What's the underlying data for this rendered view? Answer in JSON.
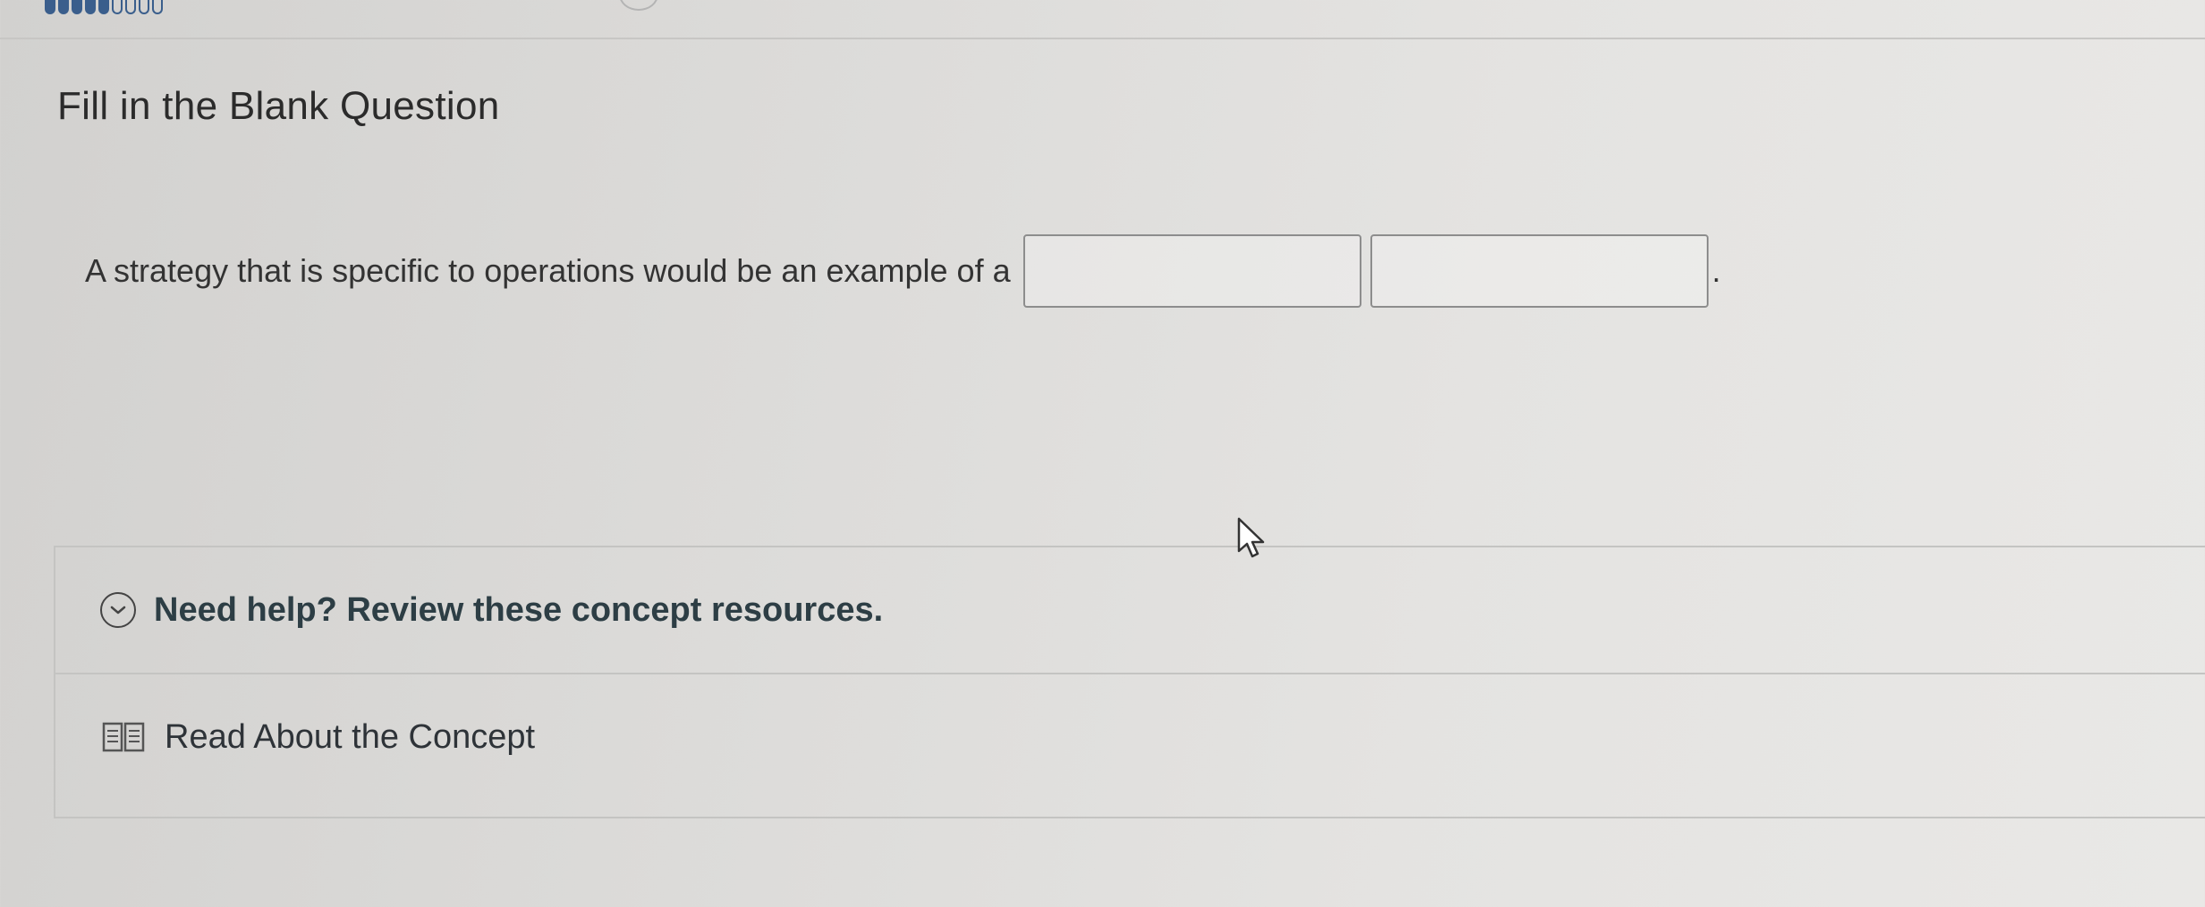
{
  "progress": {
    "segments_total": 9,
    "segments_filled": 5
  },
  "question": {
    "title": "Fill in the Blank Question",
    "prompt": "A strategy that is specific to operations would be an example of a",
    "blank_1_value": "",
    "blank_2_value": "",
    "trailing_punctuation": "."
  },
  "help": {
    "toggle_label": "Need help? Review these concept resources.",
    "toggle_icon": "chevron-down-circle-icon",
    "resources": [
      {
        "label": "Read About the Concept",
        "icon": "book-icon"
      }
    ]
  },
  "colors": {
    "progress": "#3a5e8c",
    "text": "#2e2e2e",
    "help_text": "#2d3e45",
    "border": "#c4c4c2",
    "input_border": "#8d8d8d"
  }
}
